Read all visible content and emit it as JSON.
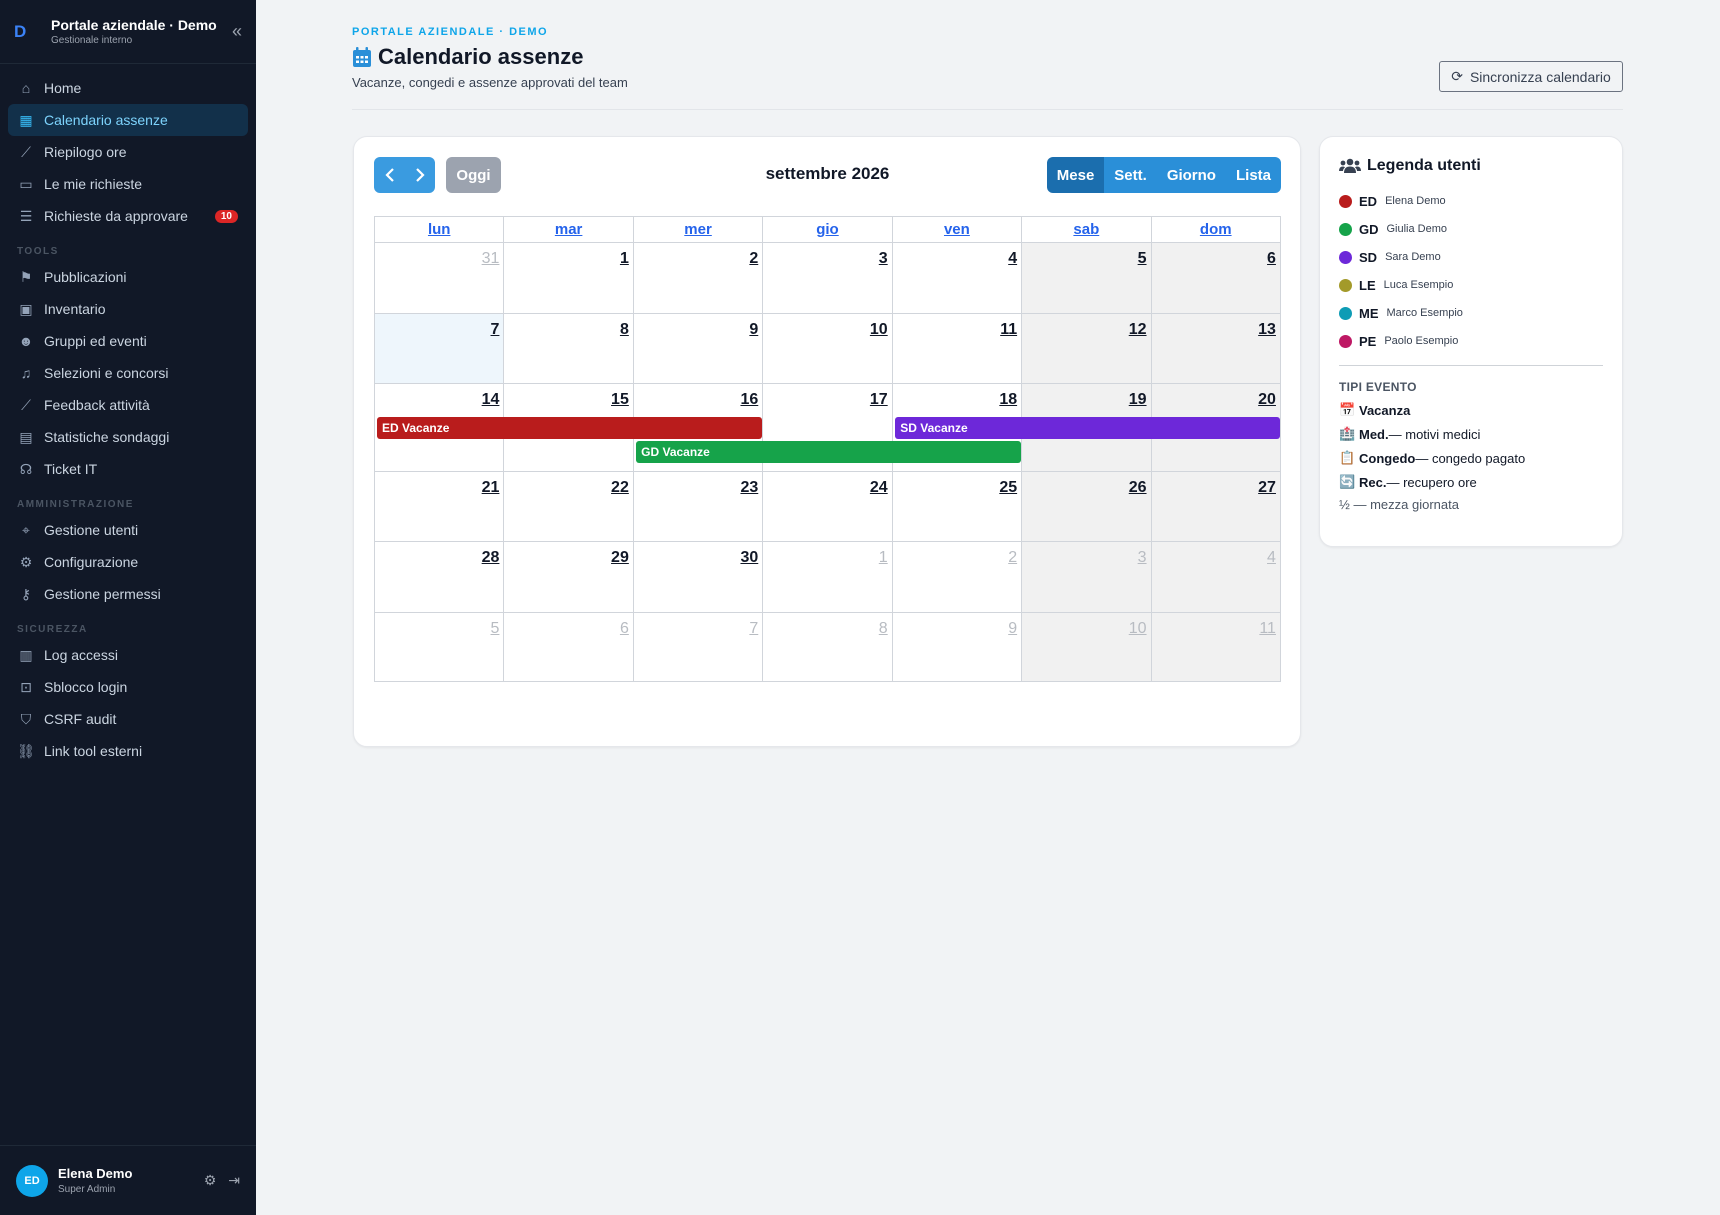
{
  "brand": {
    "logo": "D",
    "title": "Portale aziendale · Demo",
    "subtitle": "Gestionale interno",
    "collapse_icon": "«"
  },
  "nav": {
    "main": [
      {
        "label": "Home",
        "icon": "home-icon",
        "glyph": "⌂"
      },
      {
        "label": "Calendario assenze",
        "icon": "calendar-icon",
        "glyph": "▦",
        "active": true
      },
      {
        "label": "Riepilogo ore",
        "icon": "chart-line-icon",
        "glyph": "⟋"
      },
      {
        "label": "Le mie richieste",
        "icon": "clipboard-icon",
        "glyph": "▭"
      },
      {
        "label": "Richieste da approvare",
        "icon": "list-check-icon",
        "glyph": "☰",
        "badge": "10"
      }
    ],
    "tools_label": "TOOLS",
    "tools": [
      {
        "label": "Pubblicazioni",
        "icon": "bookmark-icon",
        "glyph": "⚑"
      },
      {
        "label": "Inventario",
        "icon": "boxes-icon",
        "glyph": "▣"
      },
      {
        "label": "Gruppi ed eventi",
        "icon": "users-icon",
        "glyph": "☻"
      },
      {
        "label": "Selezioni e concorsi",
        "icon": "music-icon",
        "glyph": "♫"
      },
      {
        "label": "Feedback attività",
        "icon": "chart-line-icon",
        "glyph": "⟋"
      },
      {
        "label": "Statistiche sondaggi",
        "icon": "poll-icon",
        "glyph": "▤"
      },
      {
        "label": "Ticket IT",
        "icon": "headset-icon",
        "glyph": "☊"
      }
    ],
    "admin_label": "AMMINISTRAZIONE",
    "admin": [
      {
        "label": "Gestione utenti",
        "icon": "user-lock-icon",
        "glyph": "⌖"
      },
      {
        "label": "Configurazione",
        "icon": "gear-icon",
        "glyph": "⚙"
      },
      {
        "label": "Gestione permessi",
        "icon": "key-icon",
        "glyph": "⚷"
      }
    ],
    "security_label": "SICUREZZA",
    "security": [
      {
        "label": "Log accessi",
        "icon": "clipboard-list-icon",
        "glyph": "▥"
      },
      {
        "label": "Sblocco login",
        "icon": "unlock-icon",
        "glyph": "⊡"
      },
      {
        "label": "CSRF audit",
        "icon": "shield-icon",
        "glyph": "⛉"
      },
      {
        "label": "Link tool esterni",
        "icon": "link-icon",
        "glyph": "⛓"
      }
    ]
  },
  "user": {
    "initials": "ED",
    "name": "Elena Demo",
    "role": "Super Admin"
  },
  "header": {
    "eyebrow": "PORTALE AZIENDALE · DEMO",
    "title": "Calendario assenze",
    "subtitle": "Vacanze, congedi e assenze approvati del team",
    "sync_label": "Sincronizza calendario"
  },
  "calendar": {
    "today_label": "Oggi",
    "month_title": "settembre 2026",
    "views": [
      "Mese",
      "Sett.",
      "Giorno",
      "Lista"
    ],
    "active_view": "Mese",
    "weekdays": [
      "lun",
      "mar",
      "mer",
      "gio",
      "ven",
      "sab",
      "dom"
    ],
    "weeks": [
      {
        "days": [
          "31",
          "1",
          "2",
          "3",
          "4",
          "5",
          "6"
        ],
        "other": [
          0
        ]
      },
      {
        "days": [
          "7",
          "8",
          "9",
          "10",
          "11",
          "12",
          "13"
        ],
        "other": [],
        "today": 0
      },
      {
        "days": [
          "14",
          "15",
          "16",
          "17",
          "18",
          "19",
          "20"
        ],
        "other": []
      },
      {
        "days": [
          "21",
          "22",
          "23",
          "24",
          "25",
          "26",
          "27"
        ],
        "other": []
      },
      {
        "days": [
          "28",
          "29",
          "30",
          "1",
          "2",
          "3",
          "4"
        ],
        "other": [
          3,
          4,
          5,
          6
        ]
      },
      {
        "days": [
          "5",
          "6",
          "7",
          "8",
          "9",
          "10",
          "11"
        ],
        "other": [
          0,
          1,
          2,
          3,
          4,
          5,
          6
        ]
      }
    ],
    "events": [
      {
        "label": "ED Vacanze",
        "week": 2,
        "start": 0,
        "end": 2,
        "lane": 0,
        "color": "#b91c1c"
      },
      {
        "label": "SD Vacanze",
        "week": 2,
        "start": 4,
        "end": 6,
        "lane": 0,
        "color": "#6d28d9"
      },
      {
        "label": "GD Vacanze",
        "week": 2,
        "start": 2,
        "end": 4,
        "lane": 1,
        "color": "#16a34a"
      }
    ]
  },
  "legend": {
    "title": "Legenda utenti",
    "users": [
      {
        "initials": "ED",
        "name": "Elena Demo",
        "color": "#b91c1c"
      },
      {
        "initials": "GD",
        "name": "Giulia Demo",
        "color": "#16a34a"
      },
      {
        "initials": "SD",
        "name": "Sara Demo",
        "color": "#6d28d9"
      },
      {
        "initials": "LE",
        "name": "Luca Esempio",
        "color": "#a39a2a"
      },
      {
        "initials": "ME",
        "name": "Marco Esempio",
        "color": "#0e9cb5"
      },
      {
        "initials": "PE",
        "name": "Paolo Esempio",
        "color": "#be1864"
      }
    ],
    "types_title": "TIPI EVENTO",
    "types": [
      {
        "icon": "📅",
        "name": "Vacanza",
        "desc": ""
      },
      {
        "icon": "🏥",
        "name": "Med.",
        "desc": " — motivi medici"
      },
      {
        "icon": "📋",
        "name": "Congedo",
        "desc": " — congedo pagato"
      },
      {
        "icon": "🔄",
        "name": "Rec.",
        "desc": " — recupero ore"
      }
    ],
    "half_note": "½ — mezza giornata"
  }
}
